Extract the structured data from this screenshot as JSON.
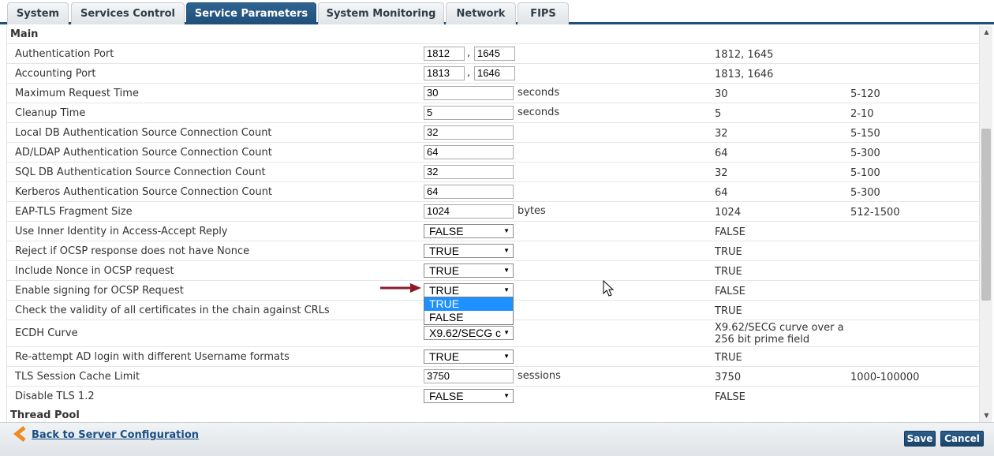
{
  "tabs": [
    {
      "label": "System",
      "active": false
    },
    {
      "label": "Services Control",
      "active": false
    },
    {
      "label": "Service Parameters",
      "active": true
    },
    {
      "label": "System Monitoring",
      "active": false
    },
    {
      "label": "Network",
      "active": false
    },
    {
      "label": "FIPS",
      "active": false
    }
  ],
  "sections": {
    "main_title": "Main",
    "thread_pool_title": "Thread Pool"
  },
  "rows": [
    {
      "label": "Authentication Port",
      "value": "1812",
      "value2": "1645",
      "separator": ",",
      "unit": "",
      "default": "1812, 1645",
      "range": ""
    },
    {
      "label": "Accounting Port",
      "value": "1813",
      "value2": "1646",
      "separator": ",",
      "unit": "",
      "default": "1813, 1646",
      "range": ""
    },
    {
      "label": "Maximum Request Time",
      "value": "30",
      "unit": "seconds",
      "default": "30",
      "range": "5-120"
    },
    {
      "label": "Cleanup Time",
      "value": "5",
      "unit": "seconds",
      "default": "5",
      "range": "2-10"
    },
    {
      "label": "Local DB Authentication Source Connection Count",
      "value": "32",
      "unit": "",
      "default": "32",
      "range": "5-150"
    },
    {
      "label": "AD/LDAP Authentication Source Connection Count",
      "value": "64",
      "unit": "",
      "default": "64",
      "range": "5-300"
    },
    {
      "label": "SQL DB Authentication Source Connection Count",
      "value": "32",
      "unit": "",
      "default": "32",
      "range": "5-100"
    },
    {
      "label": "Kerberos Authentication Source Connection Count",
      "value": "64",
      "unit": "",
      "default": "64",
      "range": "5-300"
    },
    {
      "label": "EAP-TLS Fragment Size",
      "value": "1024",
      "unit": "bytes",
      "default": "1024",
      "range": "512-1500"
    },
    {
      "label": "Use Inner Identity in Access-Accept Reply",
      "select": "FALSE",
      "default": "FALSE",
      "range": ""
    },
    {
      "label": "Reject if OCSP response does not have Nonce",
      "select": "TRUE",
      "default": "TRUE",
      "range": ""
    },
    {
      "label": "Include Nonce in OCSP request",
      "select": "TRUE",
      "default": "TRUE",
      "range": ""
    },
    {
      "label": "Enable signing for OCSP Request",
      "select": "TRUE",
      "default": "FALSE",
      "range": ""
    },
    {
      "label": "Check the validity of all certificates in the chain against CRLs",
      "select": "",
      "default": "TRUE",
      "range": ""
    },
    {
      "label": "ECDH Curve",
      "select": "X9.62/SECG c",
      "default": "X9.62/SECG curve over a",
      "default2": "256 bit prime field",
      "range": ""
    },
    {
      "label": "Re-attempt AD login with different Username formats",
      "select": "TRUE",
      "default": "TRUE",
      "range": ""
    },
    {
      "label": "TLS Session Cache Limit",
      "value": "3750",
      "unit": "sessions",
      "default": "3750",
      "range": "1000-100000"
    },
    {
      "label": "Disable TLS 1.2",
      "select": "FALSE",
      "default": "FALSE",
      "range": ""
    }
  ],
  "dropdown_open": {
    "options": [
      {
        "label": "TRUE",
        "highlighted": true
      },
      {
        "label": "FALSE",
        "highlighted": false
      }
    ]
  },
  "footer": {
    "back_label": "Back to Server Configuration",
    "save_label": "Save",
    "cancel_label": "Cancel"
  },
  "colors": {
    "accent": "#1f4f7a",
    "annotation_arrow": "#8b1a2b",
    "dropdown_highlight": "#1e90ff",
    "back_icon": "#f08a24"
  },
  "icons": [
    "chevron-down-icon",
    "back-arrow-icon",
    "annotation-arrow-icon",
    "mouse-cursor-icon",
    "scroll-up-icon",
    "scroll-down-icon"
  ]
}
